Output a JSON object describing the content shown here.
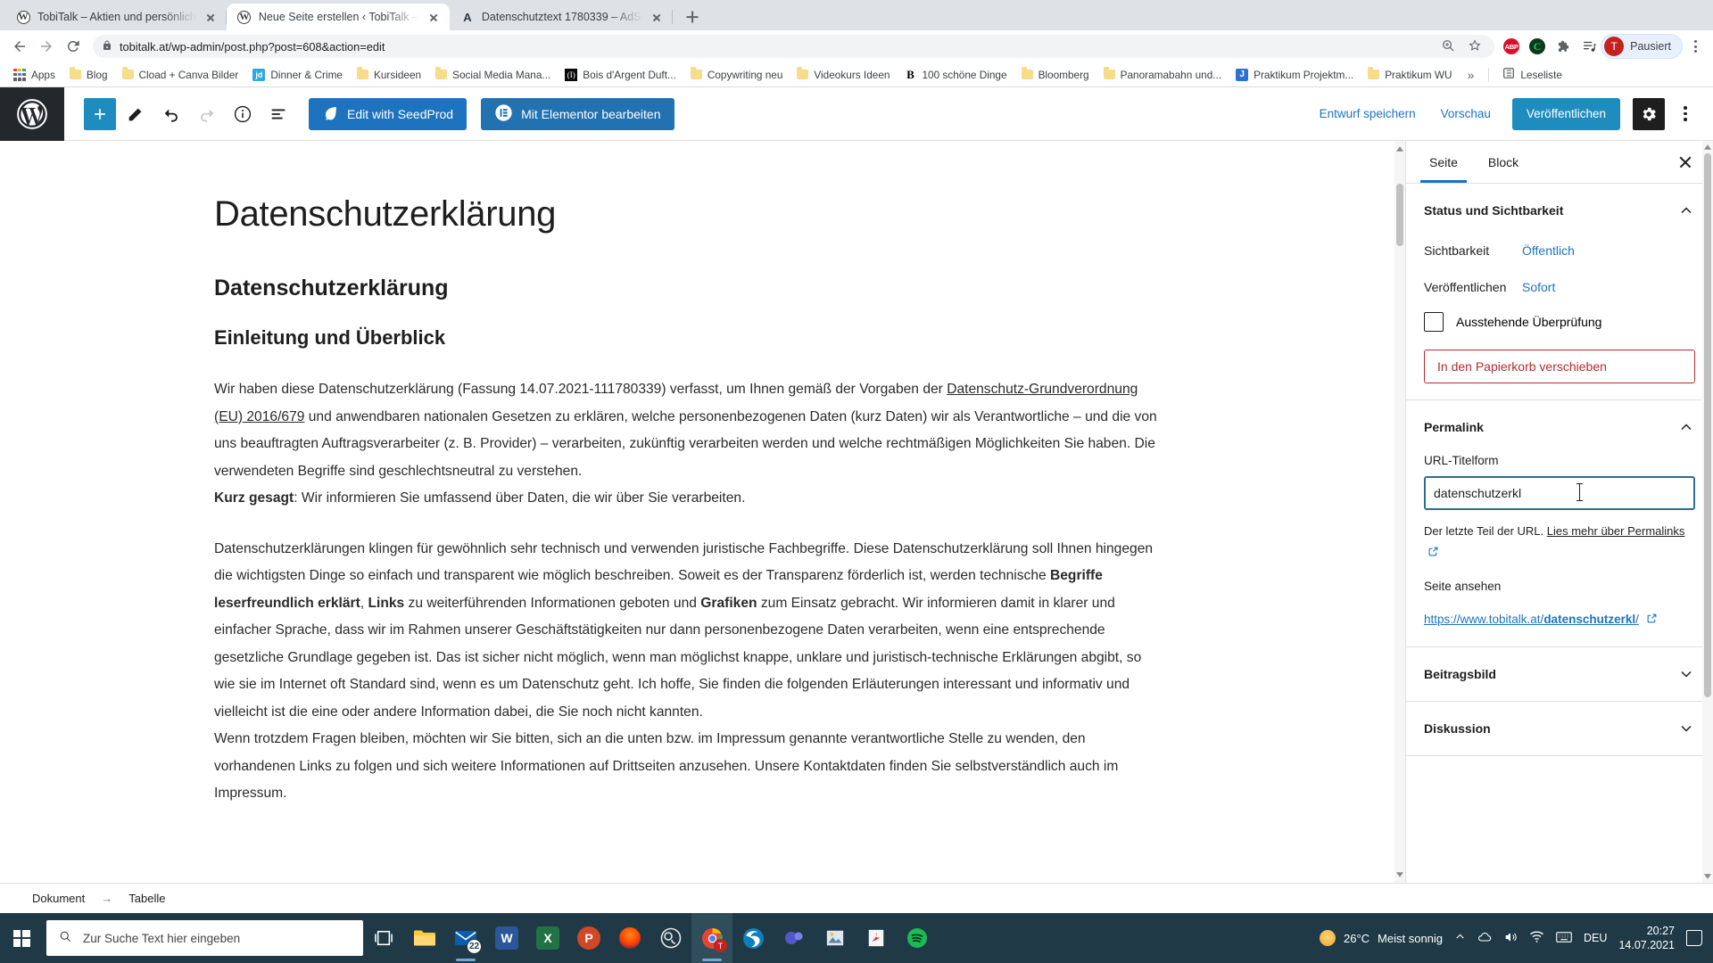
{
  "browser": {
    "tabs": [
      {
        "title": "TobiTalk – Aktien und persönlich",
        "icon": "wordpress-favicon",
        "active": false
      },
      {
        "title": "Neue Seite erstellen ‹ TobiTalk —",
        "icon": "wordpress-favicon",
        "active": true
      },
      {
        "title": "Datenschutztext 1780339 – AdSi",
        "icon": "adsimple-favicon",
        "active": false
      }
    ],
    "url": "tobitalk.at/wp-admin/post.php?post=608&action=edit",
    "profile": {
      "initial": "T",
      "label": "Pausiert"
    },
    "extensions": [
      "abp-icon",
      "c-icon",
      "puzzle-extensions-icon",
      "reading-list-icon"
    ],
    "bookmarks": [
      {
        "label": "Apps",
        "icon": "apps-grid-icon"
      },
      {
        "label": "Blog",
        "icon": "folder-icon"
      },
      {
        "label": "Cload + Canva Bilder",
        "icon": "folder-icon"
      },
      {
        "label": "Dinner & Crime",
        "icon": "jd-icon"
      },
      {
        "label": "Kursideen",
        "icon": "folder-icon"
      },
      {
        "label": "Social Media Mana...",
        "icon": "folder-icon"
      },
      {
        "label": "Bois d'Argent Duft...",
        "icon": "bois-icon"
      },
      {
        "label": "Copywriting neu",
        "icon": "folder-icon"
      },
      {
        "label": "Videokurs Ideen",
        "icon": "folder-icon"
      },
      {
        "label": "100 schöne Dinge",
        "icon": "b-icon"
      },
      {
        "label": "Bloomberg",
        "icon": "folder-icon"
      },
      {
        "label": "Panoramabahn und...",
        "icon": "folder-icon"
      },
      {
        "label": "Praktikum Projektm...",
        "icon": "j-icon"
      },
      {
        "label": "Praktikum WU",
        "icon": "folder-icon"
      }
    ],
    "bookmarks_overflow": "»",
    "reading_list": "Leseliste"
  },
  "wp": {
    "toolbar": {
      "add_block": "+",
      "seedprod_label": "Edit with SeedProd",
      "elementor_label": "Mit Elementor bearbeiten",
      "save_draft": "Entwurf speichern",
      "preview": "Vorschau",
      "publish": "Veröffentlichen"
    },
    "document": {
      "title": "Datenschutzerklärung",
      "heading2": "Datenschutzerklärung",
      "heading3": "Einleitung und Überblick",
      "p1_part1": "Wir haben diese Datenschutzerklärung (Fassung 14.07.2021-111780339) verfasst, um Ihnen gemäß der Vorgaben der ",
      "p1_link": "Datenschutz-Grundverordnung (EU) 2016/679",
      "p1_part2": " und anwendbaren nationalen Gesetzen zu erklären, welche personenbezogenen Daten (kurz Daten) wir als Verantwortliche – und die von uns beauftragten Auftragsverarbeiter (z. B. Provider) – verarbeiten, zukünftig verarbeiten werden und welche rechtmäßigen Möglichkeiten Sie haben. Die verwendeten Begriffe sind geschlechtsneutral zu verstehen.",
      "p1_bold": "Kurz gesagt",
      "p1_part3": ": Wir informieren Sie umfassend über Daten, die wir über Sie verarbeiten.",
      "p2_part1": "Datenschutzerklärungen klingen für gewöhnlich sehr technisch und verwenden juristische Fachbegriffe. Diese Datenschutzerklärung soll Ihnen hingegen die wichtigsten Dinge so einfach und transparent wie möglich beschreiben. Soweit es der Transparenz förderlich ist, werden technische ",
      "p2_bold1": "Begriffe leserfreundlich erklärt",
      "p2_part2": ", ",
      "p2_bold2": "Links",
      "p2_part3": " zu weiterführenden Informationen geboten und ",
      "p2_bold3": "Grafiken",
      "p2_part4": " zum Einsatz gebracht. Wir informieren damit in klarer und einfacher Sprache, dass wir im Rahmen unserer Geschäftstätigkeiten nur dann personenbezogene Daten verarbeiten, wenn eine entsprechende gesetzliche Grundlage gegeben ist. Das ist sicher nicht möglich, wenn man möglichst knappe, unklare und juristisch-technische Erklärungen abgibt, so wie sie im Internet oft Standard sind, wenn es um Datenschutz geht. Ich hoffe, Sie finden die folgenden Erläuterungen interessant und informativ und vielleicht ist die eine oder andere Information dabei, die Sie noch nicht kannten.",
      "p3": "Wenn trotzdem Fragen bleiben, möchten wir Sie bitten, sich an die unten bzw. im Impressum genannte verantwortliche Stelle zu wenden, den vorhandenen Links zu folgen und sich weitere Informationen auf Drittseiten anzusehen. Unsere Kontaktdaten finden Sie selbstverständlich auch im Impressum."
    },
    "sidebar": {
      "tabs": [
        {
          "label": "Seite",
          "active": true
        },
        {
          "label": "Block",
          "active": false
        }
      ],
      "status_panel": {
        "title": "Status und Sichtbarkeit",
        "visibility_label": "Sichtbarkeit",
        "visibility_value": "Öffentlich",
        "publish_label": "Veröffentlichen",
        "publish_value": "Sofort",
        "pending_review": "Ausstehende Überprüfung",
        "trash": "In den Papierkorb verschieben"
      },
      "permalink_panel": {
        "title": "Permalink",
        "slug_label": "URL-Titelform",
        "slug_value": "datenschutzerkl",
        "help_text": "Der letzte Teil der URL. ",
        "help_link": "Lies mehr über Permalinks",
        "view_label": "Seite ansehen",
        "url_base": "https://www.tobitalk.at/",
        "url_slug": "datenschutzerkl",
        "url_end": "/"
      },
      "featured_image_panel": "Beitragsbild",
      "discussion_panel": "Diskussion"
    },
    "breadcrumb": {
      "first": "Dokument",
      "sep": "→",
      "second": "Tabelle"
    }
  },
  "taskbar": {
    "search_placeholder": "Zur Suche Text hier eingeben",
    "apps": [
      {
        "name": "task-view-icon"
      },
      {
        "name": "file-explorer-icon"
      },
      {
        "name": "mail-icon",
        "badge": "22"
      },
      {
        "name": "word-icon",
        "letter": "W"
      },
      {
        "name": "excel-icon",
        "letter": "X"
      },
      {
        "name": "powerpoint-icon",
        "letter": "P"
      },
      {
        "name": "app-icon"
      },
      {
        "name": "obs-icon"
      },
      {
        "name": "chrome-icon"
      },
      {
        "name": "edge-icon"
      },
      {
        "name": "teams-icon"
      },
      {
        "name": "photo-icon"
      },
      {
        "name": "acrobat-icon"
      },
      {
        "name": "spotify-icon"
      }
    ],
    "weather": {
      "temp": "26°C",
      "condition": "Meist sonnig"
    },
    "language": "DEU",
    "time": "20:27",
    "date": "14.07.2021"
  }
}
